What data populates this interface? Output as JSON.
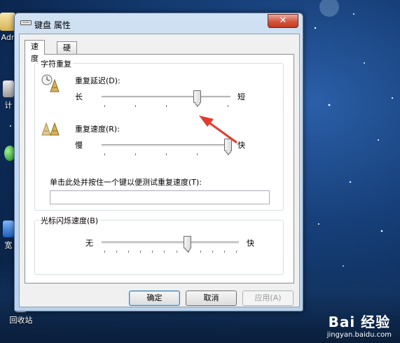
{
  "window": {
    "title": "键盘 属性",
    "close_symbol": "✕"
  },
  "tabs": [
    {
      "label": "速度",
      "active": true
    },
    {
      "label": "硬件",
      "active": false
    }
  ],
  "char_repeat": {
    "group_title": "字符重复",
    "delay": {
      "label": "重复延迟(D):",
      "min_label": "长",
      "max_label": "短",
      "value_fraction": 0.75,
      "icon": "repeat-delay-icon"
    },
    "rate": {
      "label": "重复速度(R):",
      "min_label": "慢",
      "max_label": "快",
      "value_fraction": 1.0,
      "icon": "repeat-rate-icon"
    },
    "test_label": "单击此处并按住一个键以便测试重复速度(T):",
    "test_value": ""
  },
  "cursor_blink": {
    "group_title": "光标闪烁速度(B)",
    "min_label": "无",
    "max_label": "快",
    "value_fraction": 0.63
  },
  "buttons": {
    "ok": "确定",
    "cancel": "取消",
    "apply": "应用(A)"
  },
  "desktop": {
    "icons": [
      {
        "label": "Adr",
        "icon": "user-folder-icon"
      },
      {
        "label": "计",
        "icon": "computer-icon"
      },
      {
        "label": "宽",
        "icon": "network-icon"
      },
      {
        "label": "回收站",
        "icon": "recycle-bin-icon"
      }
    ]
  },
  "watermark": {
    "logo": "Bai 经验",
    "url": "jingyan.baidu.com"
  },
  "colors": {
    "close_button": "#c23b22",
    "annotation_arrow": "#e23b2e",
    "desktop_bg": "#17407a"
  }
}
